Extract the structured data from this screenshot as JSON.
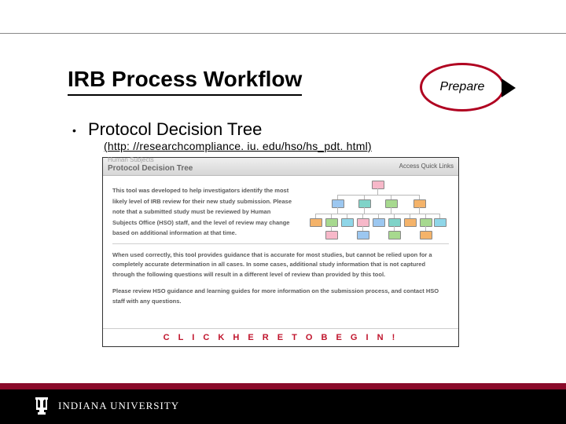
{
  "title": "IRB Process Workflow",
  "stage_label": "Prepare",
  "bullet": {
    "marker": "•",
    "heading": "Protocol Decision Tree",
    "link": "(http: //researchcompliance. iu. edu/hso/hs_pdt. html)"
  },
  "screenshot": {
    "top_small": "Human Subjects",
    "top_title": "Protocol Decision Tree",
    "quick_links": "Access Quick Links",
    "para1": "This tool was developed to help investigators identify the most likely level of IRB review for their new study submission. Please note that a submitted study must be reviewed by Human Subjects Office (HSO) staff, and the level of review may change based on additional information at that time.",
    "para2": "When used correctly, this tool provides guidance that is accurate for most studies, but cannot be relied upon for a completely accurate determination in all cases. In some cases, additional study information that is not captured through the following questions will result in a different level of review than provided by this tool.",
    "para3": "Please review HSO guidance and learning guides for more information on the submission process, and contact HSO staff with any questions.",
    "cta": "C L I C K   H E R E   T O   B E G I N !"
  },
  "footer": {
    "university": "INDIANA UNIVERSITY"
  }
}
